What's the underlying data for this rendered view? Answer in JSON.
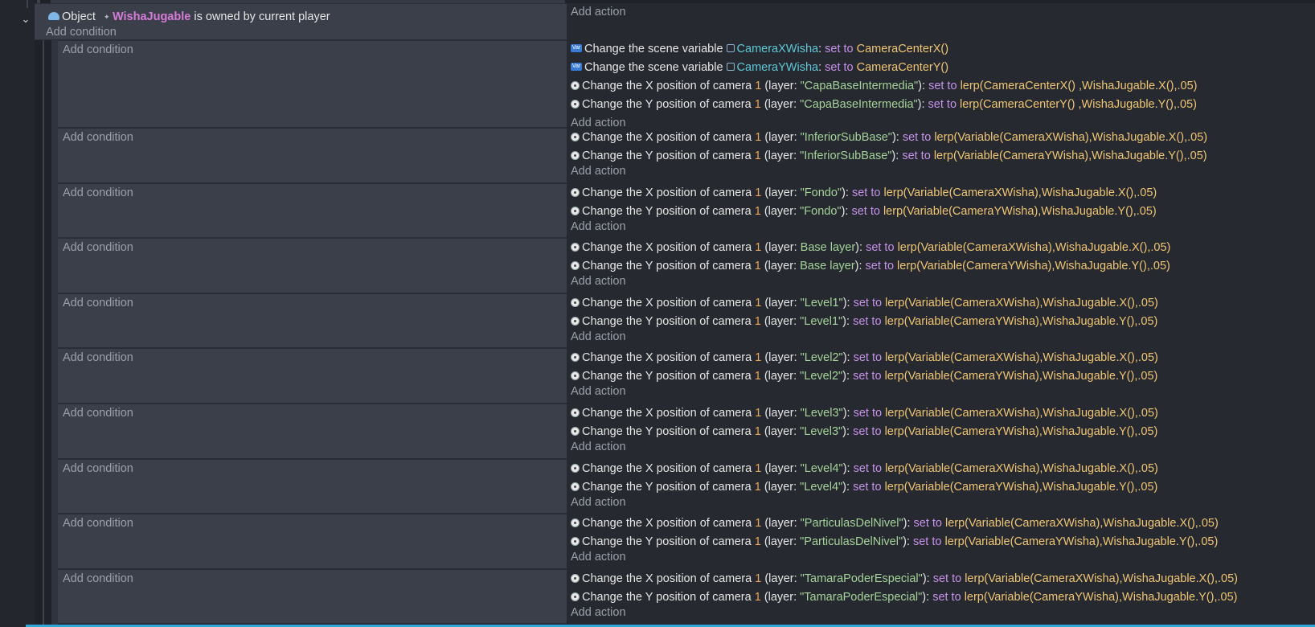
{
  "header": {
    "object_label": "Object",
    "object_name": "WishaJugable",
    "condition_suffix": "is owned by current player",
    "add_condition": "Add condition",
    "add_action": "Add action"
  },
  "labels": {
    "add_condition": "Add condition",
    "add_action": "Add action",
    "change_scene_var": "Change the scene variable",
    "set_to": "set to",
    "change_x": "Change the X position of camera",
    "change_y": "Change the Y position of camera",
    "camera_num": "1",
    "layer_prefix": "(layer: ",
    "layer_suffix": "):"
  },
  "block0": {
    "var1": "CameraXWisha",
    "var1_suffix": ":",
    "expr1": "CameraCenterX()",
    "var2": "CameraYWisha",
    "var2_suffix": ":",
    "expr2": "CameraCenterY()",
    "layer": "\"CapaBaseIntermedia\"",
    "exprx": "lerp(CameraCenterX() ,WishaJugable.X(),.05)",
    "expry": "lerp(CameraCenterY() ,WishaJugable.Y(),.05)"
  },
  "blocks": [
    {
      "layer": "\"InferiorSubBase\"",
      "quoted": true,
      "exprx": "lerp(Variable(CameraXWisha),WishaJugable.X(),.05)",
      "expry": "lerp(Variable(CameraYWisha),WishaJugable.Y(),.05)"
    },
    {
      "layer": "\"Fondo\"",
      "quoted": true,
      "exprx": "lerp(Variable(CameraXWisha),WishaJugable.X(),.05)",
      "expry": "lerp(Variable(CameraYWisha),WishaJugable.Y(),.05)"
    },
    {
      "layer": "Base layer",
      "quoted": false,
      "exprx": "lerp(Variable(CameraXWisha),WishaJugable.X(),.05)",
      "expry": "lerp(Variable(CameraYWisha),WishaJugable.Y(),.05)"
    },
    {
      "layer": "\"Level1\"",
      "quoted": true,
      "exprx": "lerp(Variable(CameraXWisha),WishaJugable.X(),.05)",
      "expry": "lerp(Variable(CameraYWisha),WishaJugable.Y(),.05)"
    },
    {
      "layer": "\"Level2\"",
      "quoted": true,
      "exprx": "lerp(Variable(CameraXWisha),WishaJugable.X(),.05)",
      "expry": "lerp(Variable(CameraYWisha),WishaJugable.Y(),.05)"
    },
    {
      "layer": "\"Level3\"",
      "quoted": true,
      "exprx": "lerp(Variable(CameraXWisha),WishaJugable.X(),.05)",
      "expry": "lerp(Variable(CameraYWisha),WishaJugable.Y(),.05)"
    },
    {
      "layer": "\"Level4\"",
      "quoted": true,
      "exprx": "lerp(Variable(CameraXWisha),WishaJugable.X(),.05)",
      "expry": "lerp(Variable(CameraYWisha),WishaJugable.Y(),.05)"
    },
    {
      "layer": "\"ParticulasDelNivel\"",
      "quoted": true,
      "exprx": "lerp(Variable(CameraXWisha),WishaJugable.X(),.05)",
      "expry": "lerp(Variable(CameraYWisha),WishaJugable.Y(),.05)"
    },
    {
      "layer": "\"TamaraPoderEspecial\"",
      "quoted": true,
      "exprx": "lerp(Variable(CameraXWisha),WishaJugable.X(),.05)",
      "expry": "lerp(Variable(CameraYWisha),WishaJugable.Y(),.05)"
    }
  ]
}
